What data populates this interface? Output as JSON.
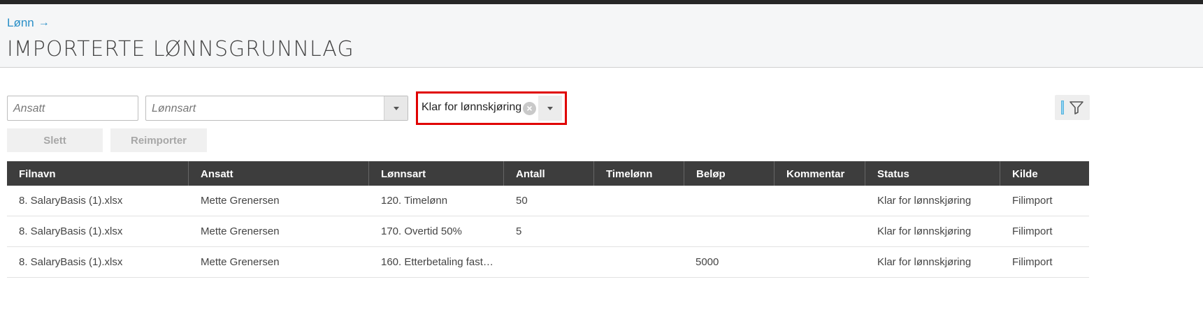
{
  "breadcrumb": {
    "label": "Lønn",
    "arrow": "→"
  },
  "page_title": "IMPORTERTE LØNNSGRUNNLAG",
  "filters": {
    "ansatt_placeholder": "Ansatt",
    "lonnsart_placeholder": "Lønnsart",
    "status_value": "Klar for lønnskjøring",
    "clear_glyph": "×"
  },
  "actions": {
    "delete_label": "Slett",
    "reimport_label": "Reimporter"
  },
  "table": {
    "columns": [
      "Filnavn",
      "Ansatt",
      "Lønnsart",
      "Antall",
      "Timelønn",
      "Beløp",
      "Kommentar",
      "Status",
      "Kilde"
    ],
    "rows": [
      [
        "8. SalaryBasis (1).xlsx",
        "Mette Grenersen",
        "120. Timelønn",
        "50",
        "",
        "",
        "",
        "Klar for lønnskjøring",
        "Filimport"
      ],
      [
        "8. SalaryBasis (1).xlsx",
        "Mette Grenersen",
        "170. Overtid 50%",
        "5",
        "",
        "",
        "",
        "Klar for lønnskjøring",
        "Filimport"
      ],
      [
        "8. SalaryBasis (1).xlsx",
        "Mette Grenersen",
        "160. Etterbetaling fast…",
        "",
        "",
        "5000",
        "",
        "Klar for lønnskjøring",
        "Filimport"
      ]
    ]
  },
  "colors": {
    "accent": "#2a8fc7",
    "header_bg": "#3d3d3d",
    "highlight": "#e00000"
  },
  "icons": {
    "filter": "funnel-icon",
    "dropdown": "chevron-down-icon",
    "clear": "clear-icon"
  }
}
